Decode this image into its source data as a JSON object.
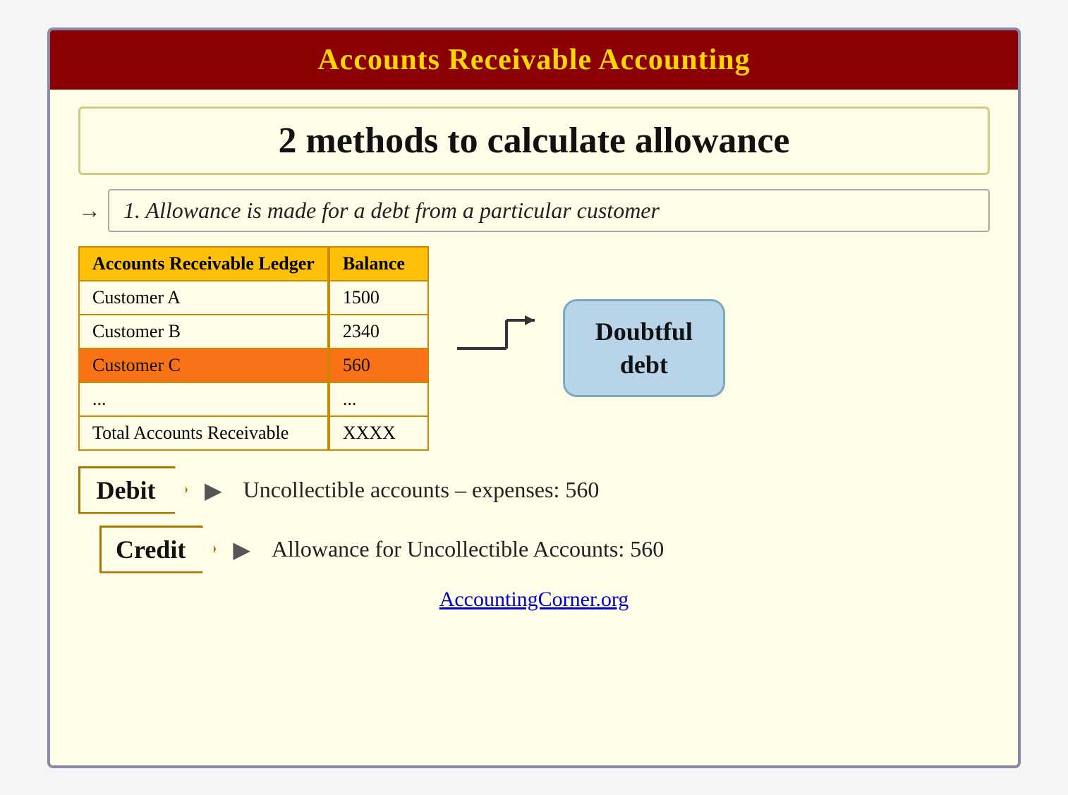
{
  "header": {
    "title": "Accounts Receivable Accounting",
    "bg_color": "#8b0000",
    "text_color": "#ffd700"
  },
  "methods_section": {
    "title": "2 methods to calculate allowance"
  },
  "method1": {
    "label": "1. Allowance is made for a debt from a particular customer"
  },
  "ledger": {
    "header": "Accounts Receivable Ledger",
    "rows": [
      {
        "name": "Customer A"
      },
      {
        "name": "Customer B"
      },
      {
        "name": "Customer C"
      },
      {
        "name": "..."
      },
      {
        "name": "Total Accounts Receivable"
      }
    ]
  },
  "balance": {
    "header": "Balance",
    "rows": [
      {
        "value": "1500"
      },
      {
        "value": "2340"
      },
      {
        "value": "560"
      },
      {
        "value": "..."
      },
      {
        "value": "XXXX"
      }
    ]
  },
  "doubtful_debt": {
    "line1": "Doubtful",
    "line2": "debt"
  },
  "debit": {
    "label": "Debit",
    "description": "Uncollectible accounts – expenses: 560"
  },
  "credit": {
    "label": "Credit",
    "description": "Allowance for Uncollectible Accounts: 560"
  },
  "website": {
    "text": "AccountingCorner.org",
    "url": "#"
  }
}
